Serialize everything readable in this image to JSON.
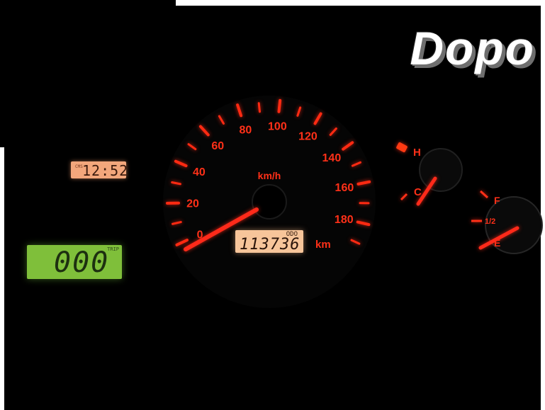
{
  "overlay": {
    "title": "Dopo"
  },
  "clock": {
    "tag": "CMS",
    "time": "12:52"
  },
  "trip": {
    "value": "000",
    "tag": "TRIP"
  },
  "speedometer": {
    "unit": "km/h",
    "labels": [
      "0",
      "20",
      "40",
      "60",
      "80",
      "100",
      "120",
      "140",
      "160",
      "180"
    ],
    "odometer_tag": "ODO",
    "odometer_value": "113736",
    "odometer_unit": "km"
  },
  "temperature": {
    "hot": "H",
    "cold": "C"
  },
  "fuel": {
    "full": "F",
    "half": "1/2",
    "empty": "E"
  },
  "colors": {
    "needle": "#ff2a1a",
    "scale": "#ff2a12",
    "clock_lcd": "#f3a77c",
    "trip_lcd": "#7fbf3a",
    "odo_lcd": "#f7c59a"
  }
}
